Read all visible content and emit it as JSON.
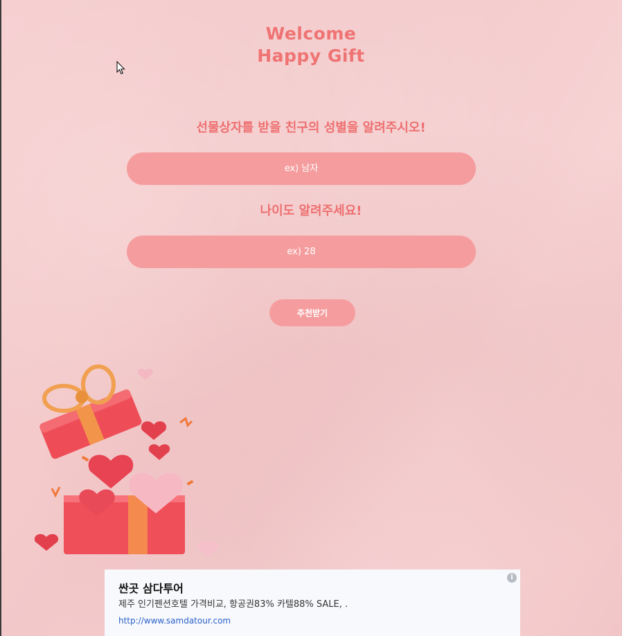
{
  "header": {
    "title_line1": "Welcome",
    "title_line2": "Happy Gift"
  },
  "form": {
    "gender_question": "선물상자를 받을 친구의 성별을 알려주시오!",
    "gender_placeholder": "ex) 남자",
    "age_question": "나이도 알려주세요!",
    "age_placeholder": "ex) 28",
    "submit_label": "추천받기"
  },
  "ad": {
    "title": "싼곳 삼다투어",
    "description": "제주 인기펜션호텔 가격비교, 항공권83% 카텔88% SALE, .",
    "url": "http://www.samdatour.com",
    "info_icon": "i"
  },
  "colors": {
    "background": "#f7d0d1",
    "accent": "#ef7373",
    "pill": "#f59d9e",
    "ad_link": "#2a62c9"
  },
  "icons": {
    "cursor": "mouse-pointer-icon",
    "info": "info-icon",
    "illustration": "gift-box-hearts-illustration"
  }
}
